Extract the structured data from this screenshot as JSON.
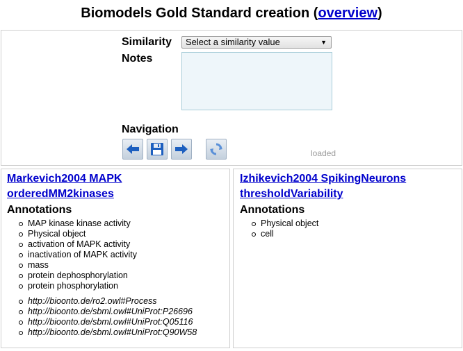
{
  "header": {
    "title": "Biomodels Gold Standard creation",
    "open_paren": "(",
    "overview_link": "overview",
    "close_paren": ")"
  },
  "form": {
    "similarity_label": "Similarity",
    "similarity_select": "Select a similarity value",
    "notes_label": "Notes",
    "navigation_label": "Navigation",
    "status": "loaded"
  },
  "left_model": {
    "title_line1": "Markevich2004 MAPK",
    "title_line2": "orderedMM2kinases",
    "annotations_heading": "Annotations",
    "annotations": [
      "MAP kinase kinase activity",
      "Physical object",
      "activation of MAPK activity",
      "inactivation of MAPK activity",
      "mass",
      "protein dephosphorylation",
      "protein phosphorylation"
    ],
    "uris": [
      "http://bioonto.de/ro2.owl#Process",
      "http://bioonto.de/sbml.owl#UniProt:P26696",
      "http://bioonto.de/sbml.owl#UniProt:Q05116",
      "http://bioonto.de/sbml.owl#UniProt:Q90W58"
    ]
  },
  "right_model": {
    "title_line1": "Izhikevich2004 SpikingNeurons",
    "title_line2": "thresholdVariability",
    "annotations_heading": "Annotations",
    "annotations": [
      "Physical object",
      "cell"
    ]
  },
  "icons": {
    "prev": "arrow-left-icon",
    "save": "floppy-disk-icon",
    "next": "arrow-right-icon",
    "refresh": "refresh-icon"
  },
  "colors": {
    "link": "#0000cc",
    "notes_bg": "#eef6fa",
    "button_arrow": "#1d5fbf"
  }
}
